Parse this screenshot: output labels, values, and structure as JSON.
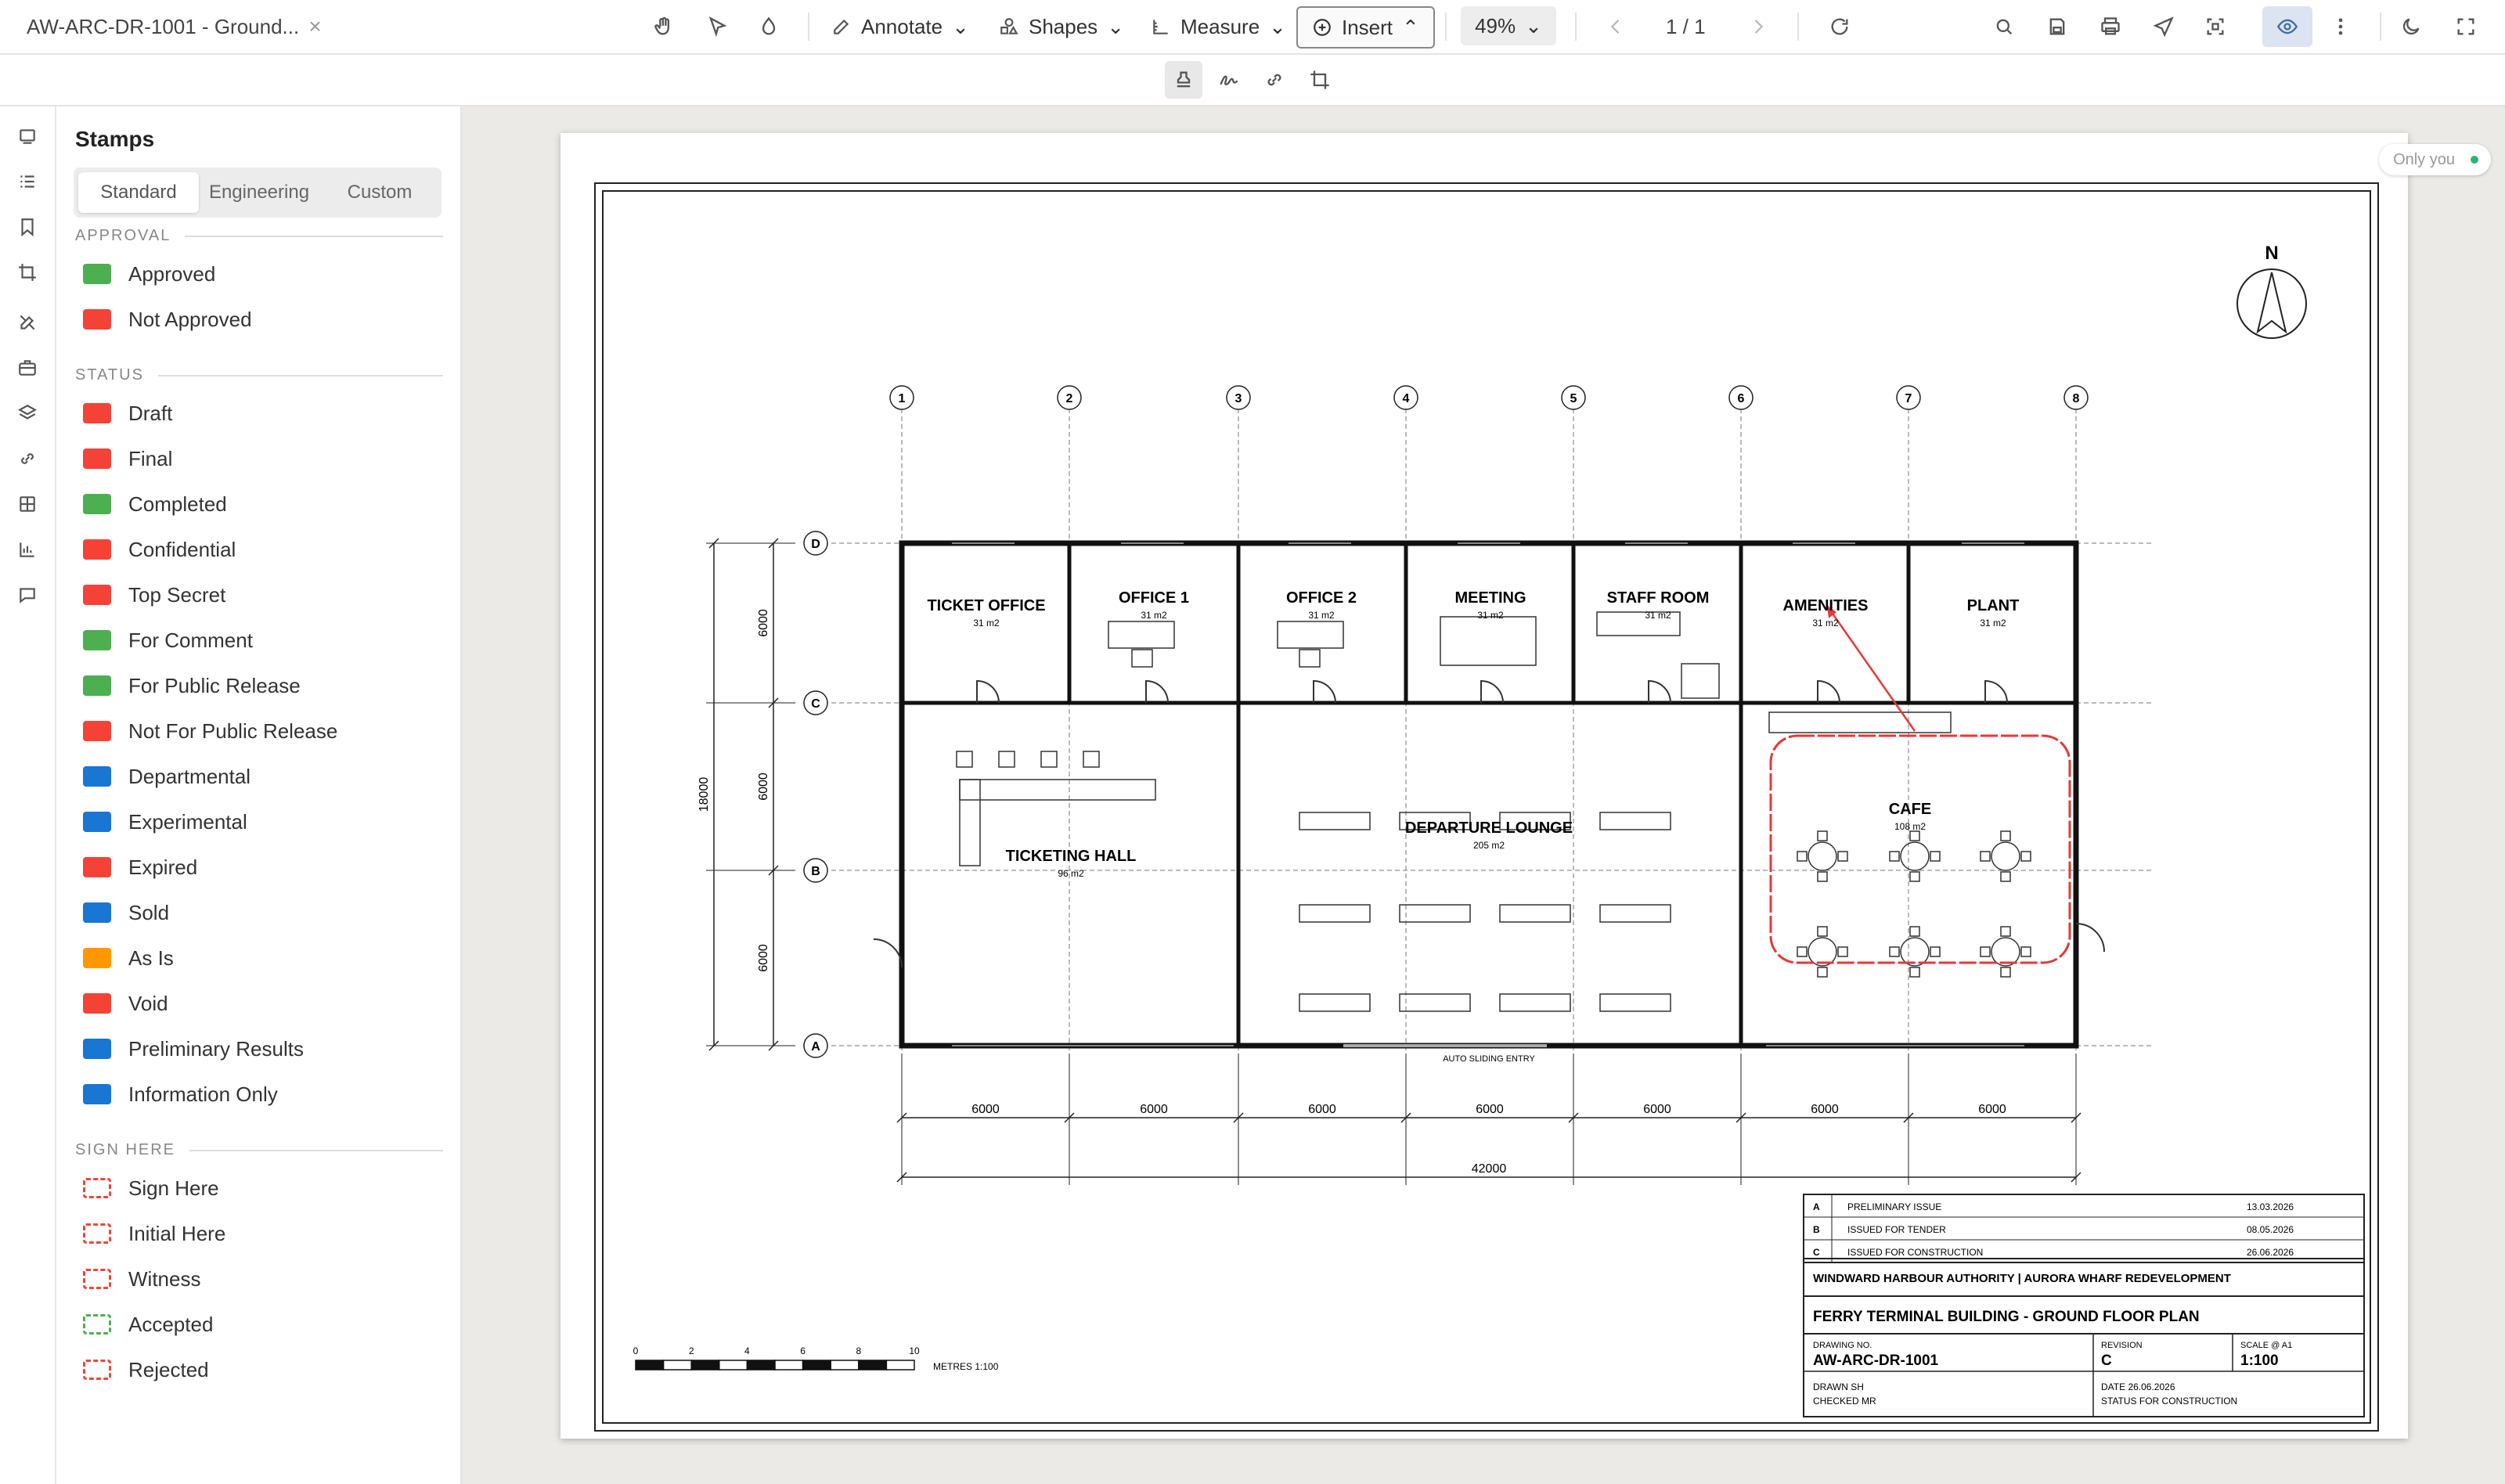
{
  "window": {
    "title": "AW-ARC-DR-1001 - Ground...",
    "close_glyph": "×"
  },
  "toolbar": {
    "annotate": "Annotate",
    "shapes": "Shapes",
    "measure": "Measure",
    "insert": "Insert",
    "zoom": "49%",
    "page_indicator": "1 / 1"
  },
  "panel": {
    "title": "Stamps",
    "tabs": [
      "Standard",
      "Engineering",
      "Custom"
    ],
    "sections": [
      {
        "label": "APPROVAL",
        "items": [
          {
            "label": "Approved",
            "color": "#4caf50",
            "style": "solid"
          },
          {
            "label": "Not Approved",
            "color": "#f44336",
            "style": "solid"
          }
        ]
      },
      {
        "label": "STATUS",
        "items": [
          {
            "label": "Draft",
            "color": "#f44336",
            "style": "solid"
          },
          {
            "label": "Final",
            "color": "#f44336",
            "style": "solid"
          },
          {
            "label": "Completed",
            "color": "#4caf50",
            "style": "solid"
          },
          {
            "label": "Confidential",
            "color": "#f44336",
            "style": "solid"
          },
          {
            "label": "Top Secret",
            "color": "#f44336",
            "style": "solid"
          },
          {
            "label": "For Comment",
            "color": "#4caf50",
            "style": "solid"
          },
          {
            "label": "For Public Release",
            "color": "#4caf50",
            "style": "solid"
          },
          {
            "label": "Not For Public Release",
            "color": "#f44336",
            "style": "solid"
          },
          {
            "label": "Departmental",
            "color": "#1976d2",
            "style": "solid"
          },
          {
            "label": "Experimental",
            "color": "#1976d2",
            "style": "solid"
          },
          {
            "label": "Expired",
            "color": "#f44336",
            "style": "solid"
          },
          {
            "label": "Sold",
            "color": "#1976d2",
            "style": "solid"
          },
          {
            "label": "As Is",
            "color": "#ff9800",
            "style": "solid"
          },
          {
            "label": "Void",
            "color": "#f44336",
            "style": "solid"
          },
          {
            "label": "Preliminary Results",
            "color": "#1976d2",
            "style": "solid"
          },
          {
            "label": "Information Only",
            "color": "#1976d2",
            "style": "solid"
          }
        ]
      },
      {
        "label": "SIGN HERE",
        "items": [
          {
            "label": "Sign Here",
            "color": "#f44336",
            "style": "dashed"
          },
          {
            "label": "Initial Here",
            "color": "#f44336",
            "style": "dashed"
          },
          {
            "label": "Witness",
            "color": "#f44336",
            "style": "dashed"
          },
          {
            "label": "Accepted",
            "color": "#4caf50",
            "style": "dashed"
          },
          {
            "label": "Rejected",
            "color": "#f44336",
            "style": "dashed"
          }
        ]
      }
    ]
  },
  "presence": {
    "label": "Only you"
  },
  "drawing": {
    "north": "N",
    "grid_columns": [
      "1",
      "2",
      "3",
      "4",
      "5",
      "6",
      "7",
      "8"
    ],
    "grid_rows": [
      "D",
      "C",
      "B",
      "A"
    ],
    "rooms": [
      {
        "name": "TICKET OFFICE",
        "area": "31 m2"
      },
      {
        "name": "OFFICE 1",
        "area": "31 m2"
      },
      {
        "name": "OFFICE 2",
        "area": "31 m2"
      },
      {
        "name": "MEETING",
        "area": "31 m2"
      },
      {
        "name": "STAFF ROOM",
        "area": "31 m2"
      },
      {
        "name": "AMENITIES",
        "area": "31 m2"
      },
      {
        "name": "PLANT",
        "area": "31 m2"
      },
      {
        "name": "TICKETING HALL",
        "area": "96 m2"
      },
      {
        "name": "DEPARTURE LOUNGE",
        "area": "205 m2"
      },
      {
        "name": "CAFE",
        "area": "108 m2"
      }
    ],
    "entry_label": "AUTO SLIDING ENTRY",
    "bay_dims": [
      "6000",
      "6000",
      "6000",
      "6000",
      "6000",
      "6000",
      "6000"
    ],
    "overall_dim": "42000",
    "vertical_dims": [
      "6000",
      "6000",
      "6000"
    ],
    "overall_vertical_dim": "18000",
    "scale_bar": {
      "ticks": [
        "0",
        "2",
        "4",
        "6",
        "8",
        "10"
      ],
      "label": "METRES  1:100"
    },
    "revisions": [
      {
        "rev": "A",
        "desc": "PRELIMINARY ISSUE",
        "date": "13.03.2026"
      },
      {
        "rev": "B",
        "desc": "ISSUED FOR TENDER",
        "date": "08.05.2026"
      },
      {
        "rev": "C",
        "desc": "ISSUED FOR CONSTRUCTION",
        "date": "26.06.2026"
      }
    ],
    "title_block": {
      "client": "WINDWARD HARBOUR AUTHORITY | AURORA WHARF REDEVELOPMENT",
      "title": "FERRY TERMINAL BUILDING - GROUND FLOOR PLAN",
      "drawing_no_label": "DRAWING NO.",
      "drawing_no": "AW-ARC-DR-1001",
      "revision_label": "REVISION",
      "revision": "C",
      "scale_label": "SCALE @ A1",
      "scale": "1:100",
      "drawn": "DRAWN  SH",
      "checked": "CHECKED  MR",
      "date": "DATE  26.06.2026",
      "status": "STATUS  FOR CONSTRUCTION"
    }
  }
}
